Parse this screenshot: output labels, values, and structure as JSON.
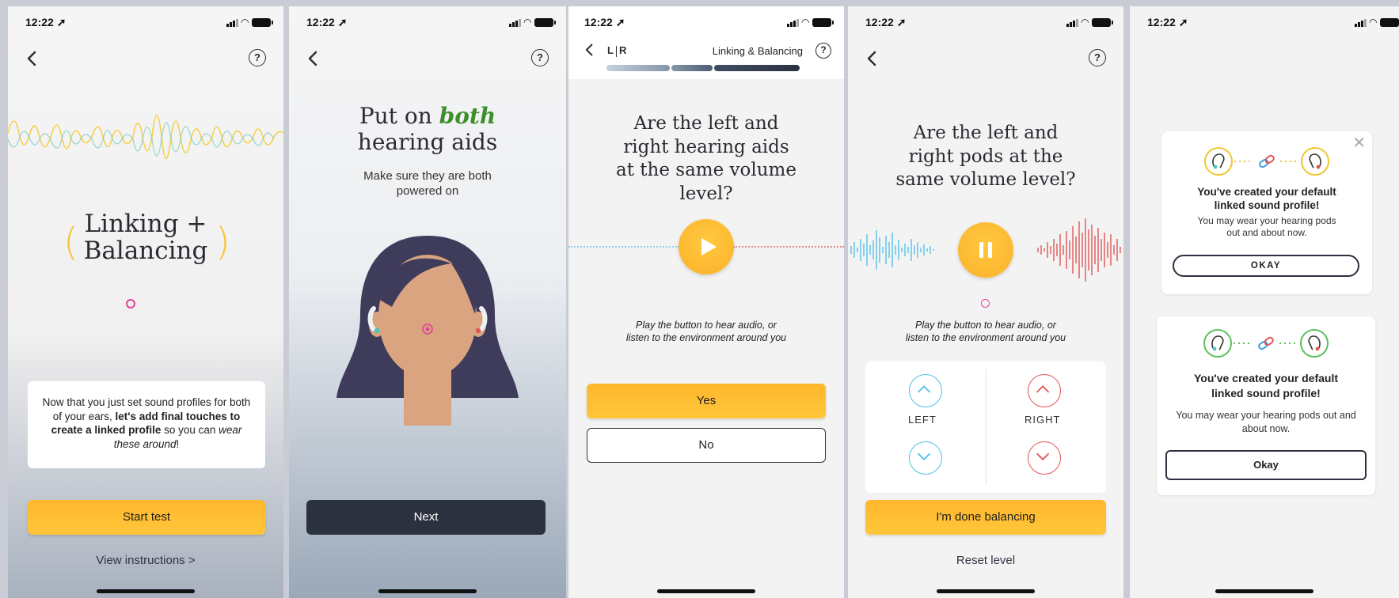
{
  "status": {
    "time": "12:22 ➚"
  },
  "screen1": {
    "title_line1": "Linking +",
    "title_line2": "Balancing",
    "card_text_parts": [
      "Now that you just set sound profiles for both of your ears, ",
      "let's add final touches to create a linked profile",
      " so you can ",
      "wear these around",
      "!"
    ],
    "start_button": "Start test",
    "instructions_link": "View instructions >",
    "colors": {
      "accent": "#ffbf33",
      "wave_yellow": "#f6cf4a",
      "wave_teal": "#7fcfc0",
      "dot": "#e0439a"
    }
  },
  "screen2": {
    "title_pre": "Put on ",
    "title_em": "both",
    "title_line2": "hearing aids",
    "subtitle_line1": "Make sure they are both",
    "subtitle_line2": "powered on",
    "next_button": "Next",
    "colors": {
      "hair": "#3f3b5b",
      "skin": "#d9a47f",
      "both": "#3d8f2a"
    }
  },
  "screen3": {
    "lr_left": "L",
    "lr_right": "R",
    "header_title": "Linking & Balancing",
    "question_lines": [
      "Are the left and",
      "right hearing aids",
      "at the same volume",
      "level?"
    ],
    "hint_line1": "Play the button to hear audio, or",
    "hint_line2": "listen to the environment around you",
    "yes_button": "Yes",
    "no_button": "No",
    "progress": {
      "completed_segments": 3,
      "total_segments": 3
    }
  },
  "screen4": {
    "question_lines": [
      "Are the left and",
      "right pods at the",
      "same volume level?"
    ],
    "hint_line1": "Play the button to hear audio, or",
    "hint_line2": "listen to the environment around you",
    "left_label": "LEFT",
    "right_label": "RIGHT",
    "done_button": "I'm done balancing",
    "reset_link": "Reset level",
    "colors": {
      "left": "#4cc3e8",
      "right": "#e05656"
    }
  },
  "screen5": {
    "modal1": {
      "title_line1": "You've created your default",
      "title_line2": "linked sound profile!",
      "body_line1": "You may wear your hearing pods",
      "body_line2": "out and about now.",
      "button": "OKAY"
    },
    "modal2": {
      "title_line1": "You've created your default",
      "title_line2": "linked sound profile!",
      "body_line1": "You may wear your hearing pods out and",
      "body_line2": "about now.",
      "button": "Okay"
    },
    "colors": {
      "modal1_ring": "#f2c531",
      "modal2_ring": "#5cbf5a",
      "link": "#3aa0e0"
    }
  }
}
